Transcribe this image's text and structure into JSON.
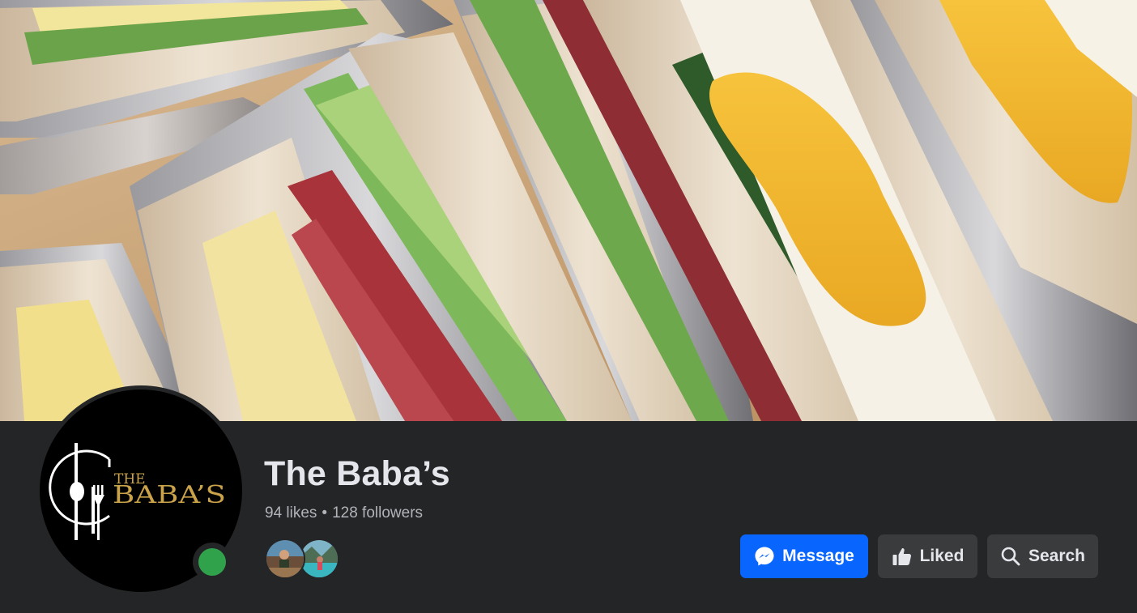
{
  "page": {
    "name": "The Baba’s",
    "likes": "94 likes",
    "separator": "•",
    "followers": "128 followers"
  },
  "logo": {
    "line1": "THE",
    "line2": "BABA’S"
  },
  "actions": {
    "message_label": "Message",
    "liked_label": "Liked",
    "search_label": "Search"
  },
  "icons": {
    "message": "messenger-icon",
    "liked": "thumbs-up-icon",
    "search": "search-icon",
    "online": "online-status-dot"
  },
  "colors": {
    "background": "#242526",
    "primary_button": "#0866ff",
    "secondary_button": "#3a3b3c",
    "online": "#31a24c",
    "logo_gold": "#c9a24a"
  }
}
